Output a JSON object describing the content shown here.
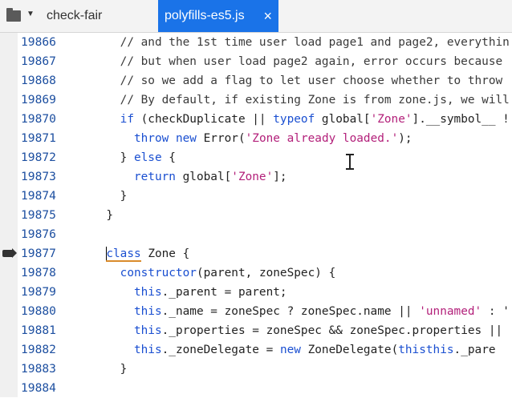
{
  "tabs": [
    {
      "label": "check-fair",
      "active": false
    },
    {
      "label": "polyfills-es5.js",
      "active": true,
      "close": "×"
    }
  ],
  "icons": {
    "folder": "folder-icon",
    "caret": "chevron-down-icon",
    "breakpoint": "execution-arrow-icon"
  },
  "lines": [
    {
      "n": "19866",
      "t": [
        [
          "cmt",
          "    // and the 1st time user load page1 and page2, everythin"
        ]
      ]
    },
    {
      "n": "19867",
      "t": [
        [
          "cmt",
          "    // but when user load page2 again, error occurs because"
        ]
      ]
    },
    {
      "n": "19868",
      "t": [
        [
          "cmt",
          "    // so we add a flag to let user choose whether to throw"
        ]
      ]
    },
    {
      "n": "19869",
      "t": [
        [
          "cmt",
          "    // By default, if existing Zone is from zone.js, we will"
        ]
      ]
    },
    {
      "n": "19870",
      "t": [
        [
          "",
          "    "
        ],
        [
          "kw",
          "if"
        ],
        [
          "",
          " (checkDuplicate || "
        ],
        [
          "kw",
          "typeof"
        ],
        [
          "",
          " global["
        ],
        [
          "str",
          "'Zone'"
        ],
        [
          "",
          "].__symbol__ !"
        ]
      ]
    },
    {
      "n": "19871",
      "t": [
        [
          "",
          "      "
        ],
        [
          "kw",
          "throw"
        ],
        [
          "",
          " "
        ],
        [
          "kw",
          "new"
        ],
        [
          "",
          " Error("
        ],
        [
          "str",
          "'Zone already loaded.'"
        ],
        [
          "",
          ");"
        ]
      ]
    },
    {
      "n": "19872",
      "t": [
        [
          "",
          "    } "
        ],
        [
          "kw",
          "else"
        ],
        [
          "",
          " {"
        ]
      ]
    },
    {
      "n": "19873",
      "t": [
        [
          "",
          "      "
        ],
        [
          "kw",
          "return"
        ],
        [
          "",
          " global["
        ],
        [
          "str",
          "'Zone'"
        ],
        [
          "",
          "];"
        ]
      ]
    },
    {
      "n": "19874",
      "t": [
        [
          "",
          "    }"
        ]
      ]
    },
    {
      "n": "19875",
      "t": [
        [
          "",
          "  }"
        ]
      ]
    },
    {
      "n": "19876",
      "t": [
        [
          "",
          ""
        ]
      ]
    },
    {
      "n": "19877",
      "t": [
        [
          "",
          "  "
        ],
        [
          "caret",
          ""
        ],
        [
          "kwhl",
          "class"
        ],
        [
          "",
          " Zone {"
        ]
      ],
      "current": true
    },
    {
      "n": "19878",
      "t": [
        [
          "",
          "    "
        ],
        [
          "kw",
          "constructor"
        ],
        [
          "",
          "(parent, zoneSpec) {"
        ]
      ]
    },
    {
      "n": "19879",
      "t": [
        [
          "",
          "      "
        ],
        [
          "kw",
          "this"
        ],
        [
          "",
          "._parent = parent;"
        ]
      ]
    },
    {
      "n": "19880",
      "t": [
        [
          "",
          "      "
        ],
        [
          "kw",
          "this"
        ],
        [
          "",
          "._name = zoneSpec ? zoneSpec.name || "
        ],
        [
          "str",
          "'unnamed'"
        ],
        [
          "",
          " : '"
        ]
      ]
    },
    {
      "n": "19881",
      "t": [
        [
          "",
          "      "
        ],
        [
          "kw",
          "this"
        ],
        [
          "",
          "._properties = zoneSpec && zoneSpec.properties ||"
        ]
      ]
    },
    {
      "n": "19882",
      "t": [
        [
          "",
          "      "
        ],
        [
          "kw",
          "this"
        ],
        [
          "",
          "._zoneDelegate = "
        ],
        [
          "kw",
          "new"
        ],
        [
          "",
          " ZoneDelegate("
        ],
        [
          "kw",
          "this"
        ],
        [
          ", "
        ],
        [
          "kw",
          "this"
        ],
        [
          "",
          "._pare"
        ]
      ]
    },
    {
      "n": "19883",
      "t": [
        [
          "",
          "    }"
        ]
      ]
    },
    {
      "n": "19884",
      "t": [
        [
          "",
          ""
        ]
      ]
    }
  ]
}
